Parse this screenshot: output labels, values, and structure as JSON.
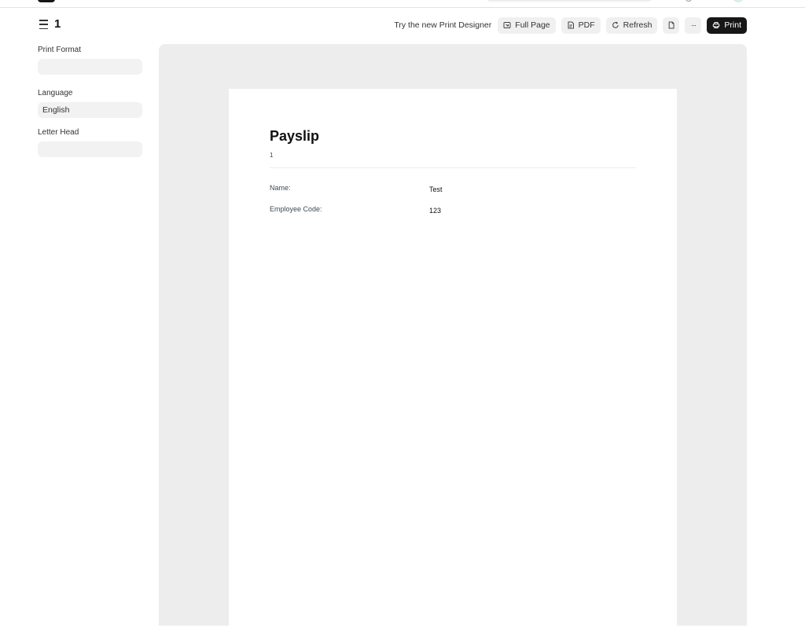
{
  "page": {
    "title": "1"
  },
  "toolbar": {
    "try_designer": "Try the new Print Designer",
    "full_page_label": "Full Page",
    "pdf_label": "PDF",
    "refresh_label": "Refresh",
    "more_label": "···",
    "print_label": "Print"
  },
  "sidebar": {
    "print_format": {
      "label": "Print Format",
      "value": ""
    },
    "language": {
      "label": "Language",
      "value": "English"
    },
    "letter_head": {
      "label": "Letter Head",
      "value": ""
    }
  },
  "document": {
    "title": "Payslip",
    "number": "1",
    "fields": [
      {
        "label": "Name:",
        "value": "Test"
      },
      {
        "label": "Employee Code:",
        "value": "123"
      }
    ]
  },
  "colors": {
    "primary_button": "#171717",
    "button_bg": "#f0f0f0",
    "preview_bg": "#ededed",
    "control_bg": "#f2f2f2"
  }
}
